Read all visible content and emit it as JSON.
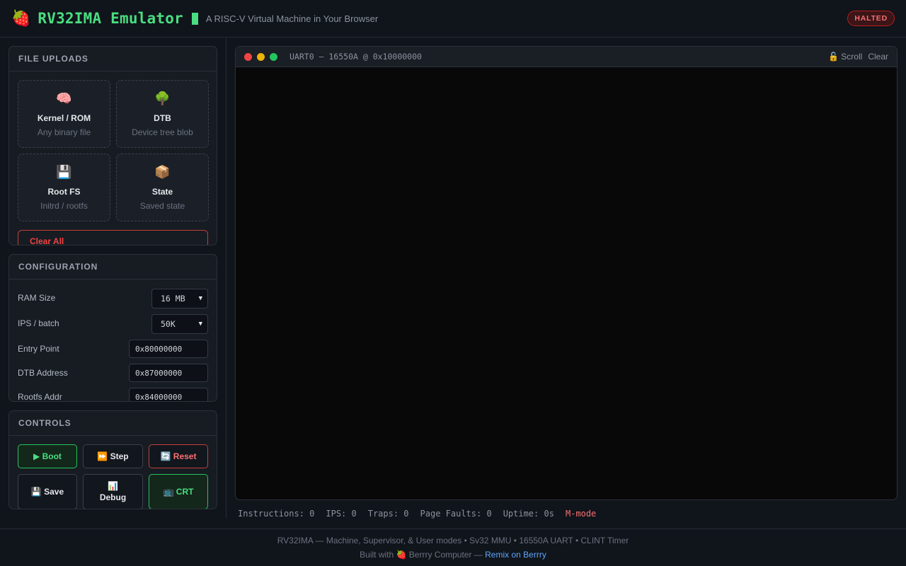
{
  "header": {
    "logo_icon": "🍓",
    "title": "RV32IMA Emulator",
    "subtitle": "A RISC-V Virtual Machine in Your Browser",
    "status": "HALTED"
  },
  "uploads": {
    "heading": "FILE UPLOADS",
    "cards": [
      {
        "icon": "🧠",
        "icon_name": "brain-icon",
        "title": "Kernel / ROM",
        "desc": "Any binary file"
      },
      {
        "icon": "🌳",
        "icon_name": "tree-icon",
        "title": "DTB",
        "desc": "Device tree blob"
      },
      {
        "icon": "💾",
        "icon_name": "floppy-disk-icon",
        "title": "Root FS",
        "desc": "Initrd / rootfs"
      },
      {
        "icon": "📦",
        "icon_name": "package-icon",
        "title": "State",
        "desc": "Saved state"
      }
    ],
    "clear_label": "Clear All"
  },
  "config": {
    "heading": "CONFIGURATION",
    "ram_label": "RAM Size",
    "ram_value": "16 MB",
    "ips_label": "IPS / batch",
    "ips_value": "50K",
    "entry_label": "Entry Point",
    "entry_value": "0x80000000",
    "dtb_label": "DTB Address",
    "dtb_value": "0x87000000",
    "rootfs_label": "Rootfs Addr",
    "rootfs_value": "0x84000000"
  },
  "controls": {
    "heading": "CONTROLS",
    "boot": "▶ Boot",
    "step": "⏩ Step",
    "reset": "🔄 Reset",
    "save": "💾 Save",
    "debug_icon": "📊",
    "debug": "Debug",
    "crt": "📺 CRT"
  },
  "terminal": {
    "title": "UART0 — 16550A @ 0x10000000",
    "scroll_label": "🔓 Scroll",
    "clear_label": "Clear",
    "dot_colors": [
      "#ef4444",
      "#eab308",
      "#22c55e"
    ]
  },
  "stats": {
    "instructions": "Instructions: 0",
    "ips": "IPS: 0",
    "traps": "Traps: 0",
    "page_faults": "Page Faults: 0",
    "uptime": "Uptime: 0s",
    "mode": "M-mode"
  },
  "footer": {
    "line1": "RV32IMA — Machine, Supervisor, & User modes • Sv32 MMU • 16550A UART • CLINT Timer",
    "built_with": "Built with 🍓 Berrry Computer — ",
    "remix_link": "Remix on Berrry"
  },
  "colors": {
    "accent": "#4ade80",
    "danger": "#ef4444",
    "link": "#60a5fa",
    "background": "#10141b"
  }
}
